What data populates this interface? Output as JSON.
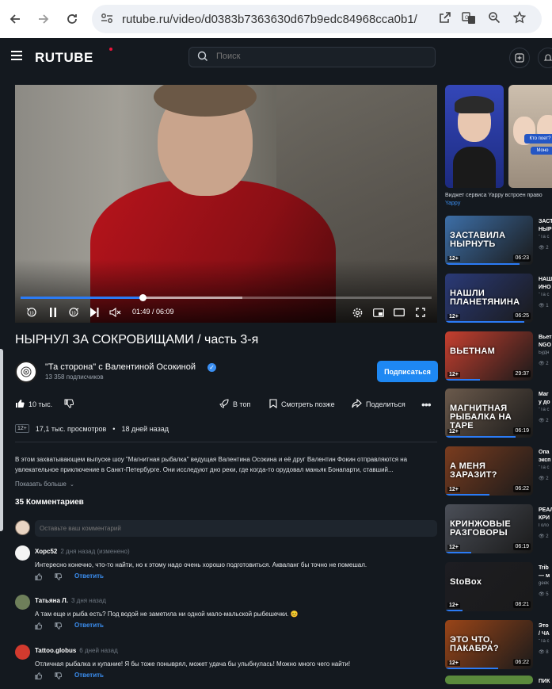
{
  "browser": {
    "url": "rutube.ru/video/d0383b7363630d67b9edc84968cca0b1/"
  },
  "header": {
    "logo": "RUTUBE",
    "search_placeholder": "Поиск"
  },
  "player": {
    "current_time": "01:49",
    "duration": "06:09",
    "time_display": "01:49 / 06:09",
    "progress_fraction": 0.296,
    "buffered_fraction": 0.54,
    "skip_back_label": "10",
    "skip_forward_label": "10"
  },
  "video": {
    "title": "НЫРНУЛ ЗА СОКРОВИЩАМИ / часть 3-я",
    "channel_name": "\"Та сторона\" с Валентиной Осокиной",
    "subscribers": "13 358 подписчиков",
    "subscribe_label": "Подписаться",
    "likes": "10 тыс.",
    "actions": {
      "top": "В топ",
      "watch_later": "Смотреть позже",
      "share": "Поделиться"
    },
    "age_rating": "12+",
    "views": "17,1 тыс. просмотров",
    "posted": "18 дней назад",
    "description": "В этом захватывающем выпуске шоу \"Магнитная рыбалка\" ведущая Валентина Осокина и её друг Валентин Фокин отправляются на увлекательное приключение в Санкт-Петербурге. Они исследуют дно реки, где когда-то орудовал маньяк Бонапарти, ставший...",
    "show_more": "Показать больше"
  },
  "comments": {
    "title": "35 Комментариев",
    "input_placeholder": "Оставьте ваш комментарий",
    "reply_label": "Ответить",
    "items": [
      {
        "author": "Хорс52",
        "meta": "2 дня назад (изменено)",
        "text": "Интересно конечно, что-то найти, но к этому надо очень хорошо подготовиться. Акваланг бы точно не помешал.",
        "avatar_color": "#f4f4f4"
      },
      {
        "author": "Татьяна Л.",
        "meta": "3 дня назад",
        "text": "А там еще и рыба есть? Под водой не заметила ни одной мало-мальской рыбешечки. 😊",
        "avatar_color": "#6e7f5a"
      },
      {
        "author": "Tattoo.globus",
        "meta": "6 дней назад",
        "text": "Отличная рыбалка и купание! Я бы тоже поныврял, может удача бы улыбнулась! Можно много чего найти!",
        "avatar_color": "#d23a2e"
      }
    ]
  },
  "sidebar": {
    "widget_caption": "Виджет сервиса Yappy встроен право",
    "widget_link": "Yappy",
    "shorts": [
      {
        "text": "Кто поет?",
        "sub": "Моно"
      }
    ],
    "recommendations": [
      {
        "thumb_text": "ЗАСТАВИЛА НЫРНУТЬ",
        "title": "ЗАСТ",
        "line2": "НЫР",
        "sub": "\"Та с",
        "views": "2",
        "age": "12+",
        "duration": "06:23",
        "bg": "#3d6fa8",
        "progress": 0.85
      },
      {
        "thumb_text": "НАШЛИ ПЛАНЕТЯНИНА",
        "title": "НАШ",
        "line2": "ИНО",
        "sub": "\"Та с",
        "views": "1",
        "age": "12+",
        "duration": "06:25",
        "bg": "#2a3a78",
        "progress": 0.9
      },
      {
        "thumb_text": "ВЬЕТНАМ",
        "title": "Вьет",
        "line2": "NGO",
        "sub": "Будн",
        "views": "2",
        "age": "12+",
        "duration": "29:37",
        "bg": "#c63f2f",
        "progress": 0.4
      },
      {
        "thumb_text": "МАГНИТНАЯ РЫБАЛКА НА ТАРЕ",
        "title": "Маг",
        "line2": "у до",
        "sub": "\"Та с",
        "views": "2",
        "age": "12+",
        "duration": "06:19",
        "bg": "#6b5a4c",
        "progress": 0.8
      },
      {
        "thumb_text": "А МЕНЯ ЗАРАЗИТ?",
        "title": "Опа",
        "line2": "эксп",
        "sub": "\"Та с",
        "views": "2",
        "age": "12+",
        "duration": "06:22",
        "bg": "#7a3c1f",
        "progress": 0.5
      },
      {
        "thumb_text": "КРИНЖОВЫЕ РАЗГОВОРЫ",
        "title": "РЕАЛ",
        "line2": "КРИ",
        "sub": "Голо",
        "views": "2",
        "age": "12+",
        "duration": "06:19",
        "bg": "#4b4f58",
        "progress": 0.3
      },
      {
        "thumb_text": "StoBox",
        "title": "Trib",
        "line2": "— м",
        "sub": "geek",
        "views": "5",
        "age": "12+",
        "duration": "08:21",
        "bg": "#1d1d22",
        "progress": 0.2
      },
      {
        "thumb_text": "ЭТО ЧТО, ПАКАБРА?",
        "title": "Это",
        "line2": "/ ЧА",
        "sub": "\"Та с",
        "views": "8",
        "age": "12+",
        "duration": "06:22",
        "bg": "#9a4518",
        "progress": 0.6
      }
    ],
    "last_title": "ПИК"
  },
  "colors": {
    "accent": "#1e88f3",
    "brand_dot": "#ed143b",
    "background": "#14191f"
  }
}
